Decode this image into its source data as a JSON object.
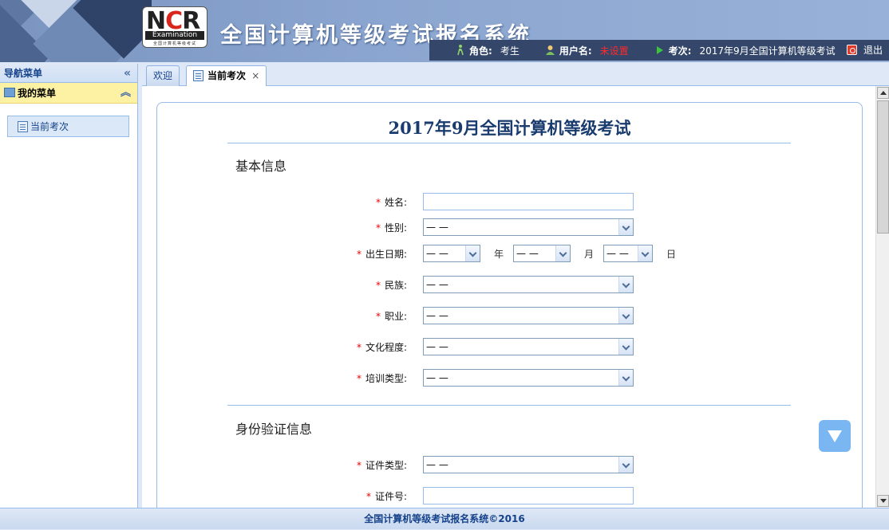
{
  "header": {
    "logo_main": "NCR",
    "logo_sub": "Examination",
    "logo_small": "全国计算机等级考试",
    "title": "全国计算机等级考试报名系统"
  },
  "userbar": {
    "role_label": "角色:",
    "role_value": "考生",
    "username_label": "用户名:",
    "username_value": "未设置",
    "exam_label": "考次:",
    "exam_value": "2017年9月全国计算机等级考试",
    "logout_label": "退出"
  },
  "sidebar": {
    "nav_title": "导航菜单",
    "collapse_glyph": "«",
    "group_title": "我的菜单",
    "group_toggle": "︽",
    "items": [
      {
        "label": "当前考次"
      }
    ]
  },
  "tabs": [
    {
      "label": "欢迎"
    },
    {
      "label": "当前考次",
      "close": "×"
    }
  ],
  "form": {
    "title": "2017年9月全国计算机等级考试",
    "section_basic": "基本信息",
    "section_id": "身份验证信息",
    "required_mark": "*",
    "fields": {
      "name": {
        "label": "姓名:",
        "value": ""
      },
      "gender": {
        "label": "性别:",
        "value": "— —"
      },
      "birth": {
        "label": "出生日期:",
        "year": "— —",
        "year_unit": "年",
        "month": "— —",
        "month_unit": "月",
        "day": "— —",
        "day_unit": "日"
      },
      "ethnicity": {
        "label": "民族:",
        "value": "— —"
      },
      "occupation": {
        "label": "职业:",
        "value": "— —"
      },
      "education": {
        "label": "文化程度:",
        "value": "— —"
      },
      "training": {
        "label": "培训类型:",
        "value": "— —"
      },
      "id_type": {
        "label": "证件类型:",
        "value": "— —"
      },
      "id_number": {
        "label": "证件号:",
        "value": ""
      }
    }
  },
  "footer": {
    "text": "全国计算机等级考试报名系统©2016"
  },
  "colors": {
    "accent": "#15428b",
    "required": "#ee0000",
    "header_bar": "#34476a"
  }
}
